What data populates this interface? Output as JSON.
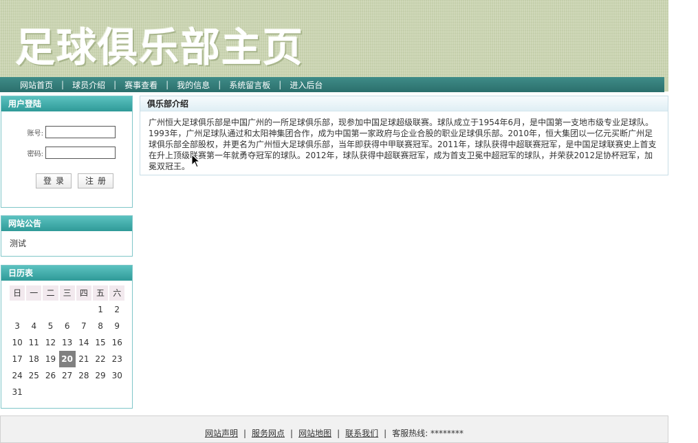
{
  "banner": {
    "title": "足球俱乐部主页"
  },
  "nav": {
    "items": [
      "网站首页",
      "球员介绍",
      "赛事查看",
      "我的信息",
      "系统留言板",
      "进入后台"
    ],
    "separator": "|"
  },
  "login": {
    "title": "用户登陆",
    "username_label": "账号:",
    "password_label": "密码:",
    "login_button": "登录",
    "register_button": "注册"
  },
  "notice": {
    "title": "网站公告",
    "text": "测试"
  },
  "calendar": {
    "title": "日历表",
    "weekdays": [
      "日",
      "一",
      "二",
      "三",
      "四",
      "五",
      "六"
    ],
    "days": [
      "",
      "",
      "",
      "",
      "",
      "1",
      "2",
      "3",
      "4",
      "5",
      "6",
      "7",
      "8",
      "9",
      "10",
      "11",
      "12",
      "13",
      "14",
      "15",
      "16",
      "17",
      "18",
      "19",
      "20",
      "21",
      "22",
      "23",
      "24",
      "25",
      "26",
      "27",
      "28",
      "29",
      "30",
      "31"
    ],
    "today": "20"
  },
  "content": {
    "title": "俱乐部介绍",
    "body": "广州恒大足球俱乐部是中国广州的一所足球俱乐部，现参加中国足球超级联赛。球队成立于1954年6月，是中国第一支地市级专业足球队。1993年，广州足球队通过和太阳神集团合作，成为中国第一家政府与企业合股的职业足球俱乐部。2010年，恒大集团以一亿元买断广州足球俱乐部全部股权，并更名为广州恒大足球俱乐部，当年即获得中甲联赛冠军。2011年，球队获得中超联赛冠军，是中国足球联赛史上首支在升上顶级联赛第一年就勇夺冠军的球队。2012年，球队获得中超联赛冠军，成为首支卫冕中超冠军的球队，并荣获2012足协杯冠军，加冕双冠王。"
  },
  "footer": {
    "links": [
      "网站声明",
      "服务网点",
      "网站地图",
      "联系我们"
    ],
    "hotline": "客服热线: ********",
    "separator": "|"
  }
}
